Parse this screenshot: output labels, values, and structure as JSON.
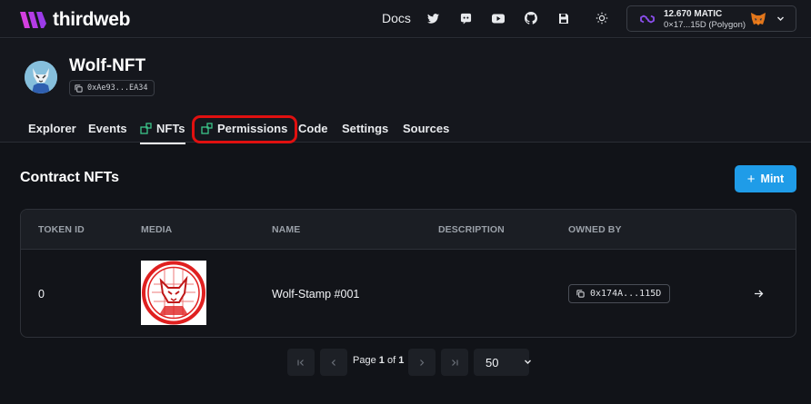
{
  "header": {
    "brand": "thirdweb",
    "docs_label": "Docs",
    "icons": [
      "twitter-icon",
      "discord-icon",
      "youtube-icon",
      "github-icon",
      "save-disk-icon",
      "theme-sun-icon"
    ],
    "wallet": {
      "balance": "12.670 MATIC",
      "address": "0×17...15D (Polygon)"
    }
  },
  "contract": {
    "name": "Wolf-NFT",
    "address": "0xAe93...EA34"
  },
  "tabs": [
    {
      "label": "Explorer"
    },
    {
      "label": "Events"
    },
    {
      "label": "NFTs",
      "active": true
    },
    {
      "label": "Permissions",
      "highlighted": true
    },
    {
      "label": "Code"
    },
    {
      "label": "Settings"
    },
    {
      "label": "Sources"
    }
  ],
  "main": {
    "title": "Contract NFTs",
    "mint_label": "Mint"
  },
  "table": {
    "columns": [
      "TOKEN ID",
      "MEDIA",
      "NAME",
      "DESCRIPTION",
      "OWNED BY"
    ],
    "rows": [
      {
        "token_id": "0",
        "name": "Wolf-Stamp #001",
        "description": "",
        "owner": "0x174A...115D"
      }
    ]
  },
  "pagination": {
    "page_prefix": "Page",
    "current": "1",
    "of": "of",
    "total": "1",
    "page_size": "50"
  },
  "colors": {
    "background": "#111318",
    "accent": "#1f9ce8",
    "highlight": "#e01010",
    "logo": "#d43fe0"
  }
}
